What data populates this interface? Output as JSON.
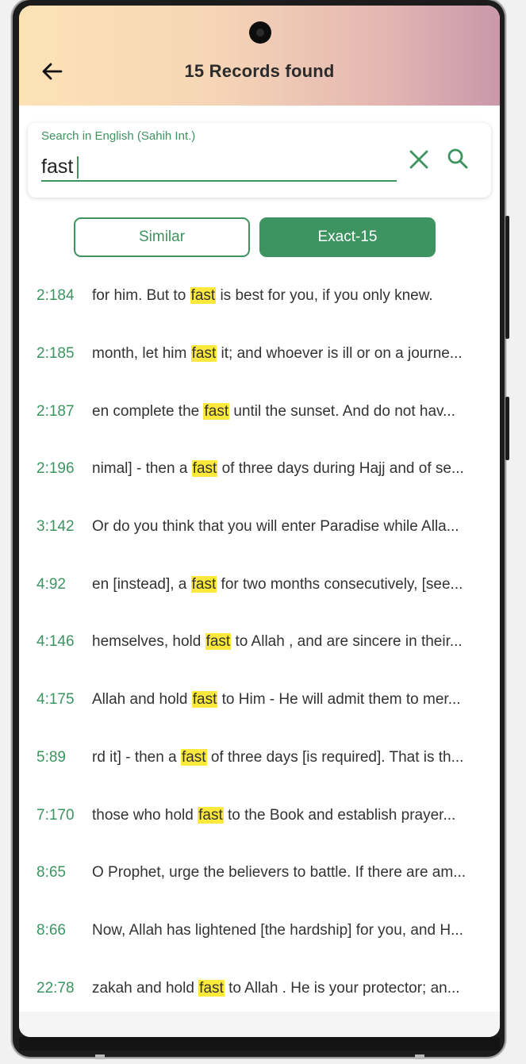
{
  "header": {
    "title": "15 Records found",
    "back_icon": "arrow-left-icon"
  },
  "search": {
    "label": "Search in English (Sahih Int.)",
    "value": "fast",
    "clear_icon": "close-icon",
    "search_icon": "search-icon"
  },
  "filters": {
    "similar_label": "Similar",
    "exact_label": "Exact-15",
    "selected": "Exact-15"
  },
  "colors": {
    "accent": "#3d9461",
    "highlight": "#fce93b"
  },
  "results": [
    {
      "ref": "2:184",
      "before": "for him. But to ",
      "match": "fast",
      "after": " is best for you, if you only knew."
    },
    {
      "ref": "2:185",
      "before": "month, let him ",
      "match": "fast",
      "after": " it; and whoever is ill or on a journe..."
    },
    {
      "ref": "2:187",
      "before": "en complete the ",
      "match": "fast",
      "after": " until the sunset. And do not hav..."
    },
    {
      "ref": "2:196",
      "before": "nimal] - then a ",
      "match": "fast",
      "after": " of three days during Hajj and of se..."
    },
    {
      "ref": "3:142",
      "before": "Or do you think that you will enter Paradise while Alla...",
      "match": "",
      "after": ""
    },
    {
      "ref": "4:92",
      "before": "en [instead], a ",
      "match": "fast",
      "after": " for two months consecutively, [see..."
    },
    {
      "ref": "4:146",
      "before": "hemselves, hold ",
      "match": "fast",
      "after": " to Allah , and are sincere in their..."
    },
    {
      "ref": "4:175",
      "before": "Allah and hold ",
      "match": "fast",
      "after": " to Him - He will admit them to mer..."
    },
    {
      "ref": "5:89",
      "before": "rd it] - then a ",
      "match": "fast",
      "after": " of three days [is required]. That is th..."
    },
    {
      "ref": "7:170",
      "before": "those who hold ",
      "match": "fast",
      "after": " to the Book and establish prayer..."
    },
    {
      "ref": "8:65",
      "before": "O Prophet, urge the believers to battle. If there are am...",
      "match": "",
      "after": ""
    },
    {
      "ref": "8:66",
      "before": "Now, Allah has lightened [the hardship] for you, and H...",
      "match": "",
      "after": ""
    },
    {
      "ref": "22:78",
      "before": "zakah and hold ",
      "match": "fast",
      "after": " to Allah . He is your protector; an..."
    }
  ]
}
